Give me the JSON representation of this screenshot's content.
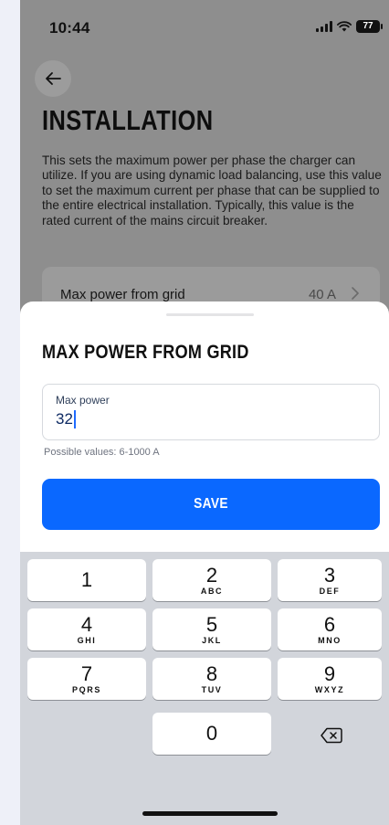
{
  "status_bar": {
    "time": "10:44",
    "battery_level": "77",
    "icons": [
      "cellular-signal-icon",
      "wifi-icon",
      "battery-icon"
    ]
  },
  "header": {
    "back_icon": "arrow-left-icon",
    "title": "INSTALLATION",
    "description": "This sets the maximum power per phase the charger can utilize. If you are using dynamic load balancing, use this value to set the maximum current per phase that can be supplied to the entire electrical installation. Typically, this value is the rated current of the mains circuit breaker."
  },
  "setting": {
    "label": "Max power from grid",
    "value": "40 A",
    "chevron_icon": "chevron-right-icon"
  },
  "sheet": {
    "title": "MAX POWER FROM GRID",
    "field_label": "Max power",
    "field_value": "32",
    "hint": "Possible values: 6-1000 A",
    "save_label": "SAVE"
  },
  "keyboard": {
    "keys": [
      {
        "digit": "1",
        "letters": ""
      },
      {
        "digit": "2",
        "letters": "ABC"
      },
      {
        "digit": "3",
        "letters": "DEF"
      },
      {
        "digit": "4",
        "letters": "GHI"
      },
      {
        "digit": "5",
        "letters": "JKL"
      },
      {
        "digit": "6",
        "letters": "MNO"
      },
      {
        "digit": "7",
        "letters": "PQRS"
      },
      {
        "digit": "8",
        "letters": "TUV"
      },
      {
        "digit": "9",
        "letters": "WXYZ"
      },
      {
        "digit": "0",
        "letters": ""
      }
    ],
    "delete_icon": "backspace-icon"
  },
  "colors": {
    "accent": "#0a68ff",
    "overlay": "#8e8e8e",
    "keyboard_bg": "#d2d5db"
  }
}
